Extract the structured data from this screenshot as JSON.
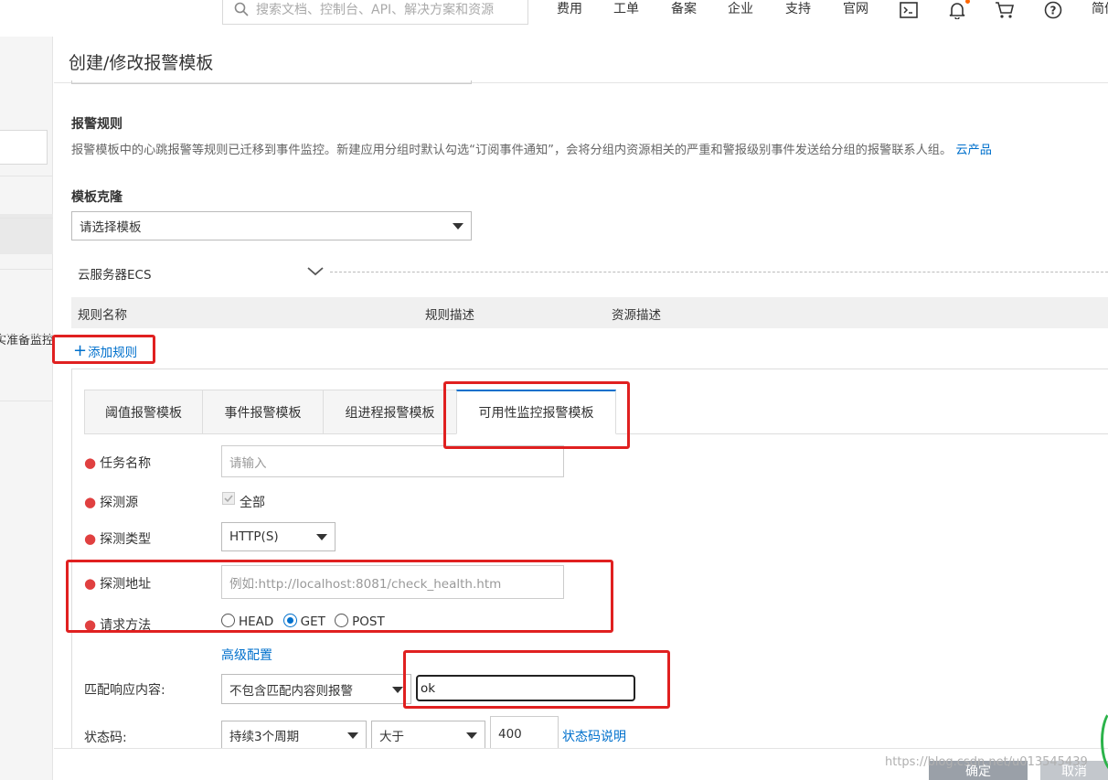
{
  "nav": {
    "search_placeholder": "搜索文档、控制台、API、解决方案和资源",
    "items": [
      "费用",
      "工单",
      "备案",
      "企业",
      "支持",
      "官网"
    ],
    "lang": "简体"
  },
  "sidebar": {
    "partial_text": "实准备监控"
  },
  "panel": {
    "title": "创建/修改报警模板",
    "alert_rules": {
      "title": "报警规则",
      "desc": "报警模板中的心跳报警等规则已迁移到事件监控。新建应用分组时默认勾选“订阅事件通知”，会将分组内资源相关的严重和警报级别事件发送给分组的报警联系人组。",
      "link": "云产品"
    },
    "template_clone": {
      "title": "模板克隆",
      "placeholder": "请选择模板"
    },
    "ecs_label": "云服务器ECS",
    "table_headers": [
      "规则名称",
      "规则描述",
      "资源描述"
    ],
    "add_rule": "添加规则"
  },
  "tabs": [
    "阈值报警模板",
    "事件报警模板",
    "组进程报警模板",
    "可用性监控报警模板"
  ],
  "form": {
    "task_name": {
      "label": "任务名称",
      "placeholder": "请输入"
    },
    "probe_source": {
      "label": "探测源",
      "option": "全部"
    },
    "probe_type": {
      "label": "探测类型",
      "value": "HTTP(S)"
    },
    "probe_url": {
      "label": "探测地址",
      "placeholder": "例如:http://localhost:8081/check_health.htm"
    },
    "method": {
      "label": "请求方法",
      "options": [
        "HEAD",
        "GET",
        "POST"
      ],
      "selected": "GET"
    },
    "advanced": "高级配置",
    "match": {
      "label": "匹配响应内容:",
      "mode": "不包含匹配内容则报警",
      "value": "ok"
    },
    "status": {
      "label": "状态码:",
      "period": "持续3个周期",
      "op": "大于",
      "code": "400",
      "help": "状态码说明"
    }
  },
  "footer": {
    "confirm": "确定",
    "cancel": "取消",
    "watermark": "https://blog.csdn.net/u013545439"
  },
  "colors": {
    "link": "#0070cc",
    "highlight": "#e02020",
    "required": "#e04040"
  }
}
